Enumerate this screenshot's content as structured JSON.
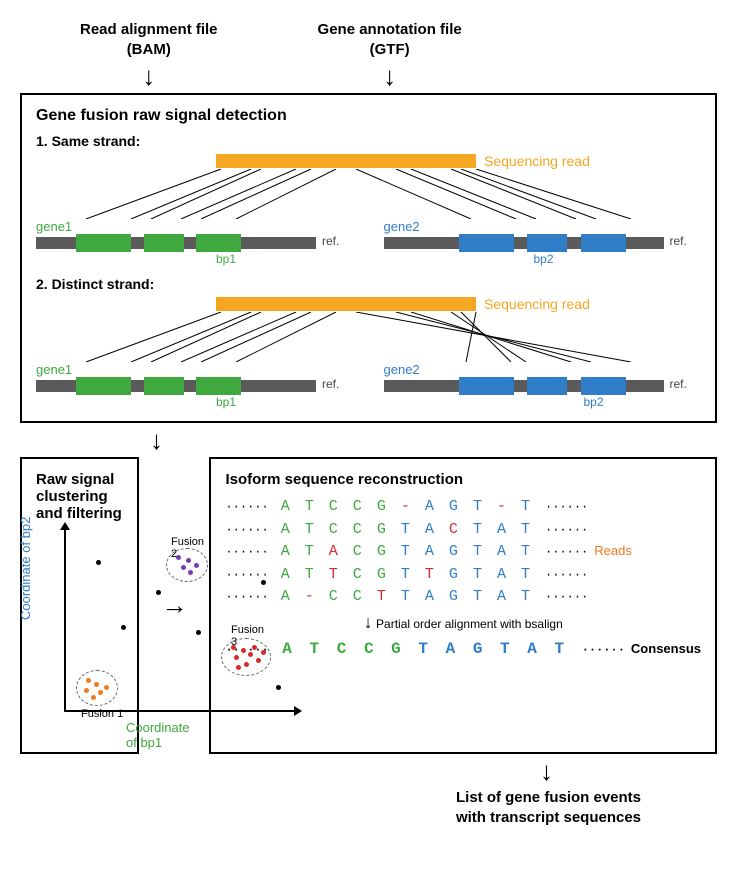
{
  "inputs": {
    "bam": {
      "line1": "Read alignment file",
      "line2": "(BAM)"
    },
    "gtf": {
      "line1": "Gene annotation file",
      "line2": "(GTF)"
    }
  },
  "detection": {
    "title": "Gene fusion raw signal detection",
    "same_strand_heading": "1. Same strand:",
    "distinct_strand_heading": "2. Distinct strand:",
    "sequencing_read": "Sequencing read",
    "gene1": "gene1",
    "gene2": "gene2",
    "ref": "ref.",
    "bp1": "bp1",
    "bp2": "bp2"
  },
  "clustering": {
    "title": "Raw signal clustering and filtering",
    "y_axis": "Coordinate of bp2",
    "x_axis": "Coordinate of bp1",
    "fusions": {
      "f1": "Fusion 1",
      "f2": "Fusion 2",
      "f3": "Fusion 3"
    }
  },
  "isoform": {
    "title": "Isoform sequence reconstruction",
    "reads_label": "Reads",
    "poa_caption": "Partial order alignment\nwith bsalign",
    "consensus_label": "Consensus",
    "reads": [
      [
        [
          "g",
          "A"
        ],
        [
          "g",
          "T"
        ],
        [
          "g",
          "C"
        ],
        [
          "g",
          "C"
        ],
        [
          "g",
          "G"
        ],
        [
          "r",
          "-"
        ],
        [
          "b",
          "A"
        ],
        [
          "b",
          "G"
        ],
        [
          "b",
          "T"
        ],
        [
          "r",
          "-"
        ],
        [
          "b",
          "T"
        ]
      ],
      [
        [
          "g",
          "A"
        ],
        [
          "g",
          "T"
        ],
        [
          "g",
          "C"
        ],
        [
          "g",
          "C"
        ],
        [
          "g",
          "G"
        ],
        [
          "b",
          "T"
        ],
        [
          "b",
          "A"
        ],
        [
          "r",
          "C"
        ],
        [
          "b",
          "T"
        ],
        [
          "b",
          "A"
        ],
        [
          "b",
          "T"
        ]
      ],
      [
        [
          "g",
          "A"
        ],
        [
          "g",
          "T"
        ],
        [
          "r",
          "A"
        ],
        [
          "g",
          "C"
        ],
        [
          "g",
          "G"
        ],
        [
          "b",
          "T"
        ],
        [
          "b",
          "A"
        ],
        [
          "b",
          "G"
        ],
        [
          "b",
          "T"
        ],
        [
          "b",
          "A"
        ],
        [
          "b",
          "T"
        ]
      ],
      [
        [
          "g",
          "A"
        ],
        [
          "g",
          "T"
        ],
        [
          "r",
          "T"
        ],
        [
          "g",
          "C"
        ],
        [
          "g",
          "G"
        ],
        [
          "b",
          "T"
        ],
        [
          "r",
          "T"
        ],
        [
          "b",
          "G"
        ],
        [
          "b",
          "T"
        ],
        [
          "b",
          "A"
        ],
        [
          "b",
          "T"
        ]
      ],
      [
        [
          "g",
          "A"
        ],
        [
          "r",
          "-"
        ],
        [
          "g",
          "C"
        ],
        [
          "g",
          "C"
        ],
        [
          "r",
          "T"
        ],
        [
          "b",
          "T"
        ],
        [
          "b",
          "A"
        ],
        [
          "b",
          "G"
        ],
        [
          "b",
          "T"
        ],
        [
          "b",
          "A"
        ],
        [
          "b",
          "T"
        ]
      ]
    ],
    "consensus": [
      [
        "g",
        "A"
      ],
      [
        "g",
        "T"
      ],
      [
        "g",
        "C"
      ],
      [
        "g",
        "C"
      ],
      [
        "g",
        "G"
      ],
      [
        "b",
        "T"
      ],
      [
        "b",
        "A"
      ],
      [
        "b",
        "G"
      ],
      [
        "b",
        "T"
      ],
      [
        "b",
        "A"
      ],
      [
        "b",
        "T"
      ]
    ]
  },
  "output": {
    "line1": "List of gene fusion events",
    "line2": "with transcript sequences"
  }
}
